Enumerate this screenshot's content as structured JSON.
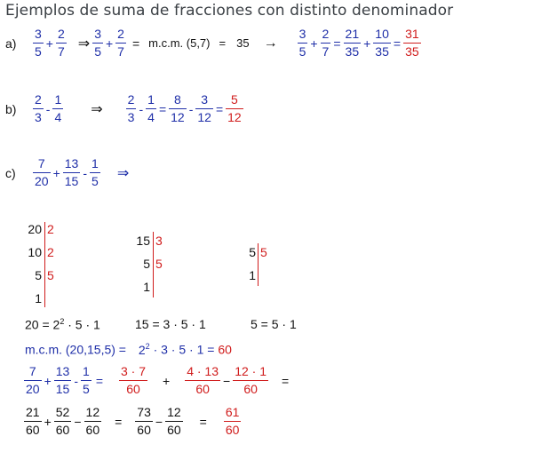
{
  "title": "Ejemplos de suma de fracciones con distinto denominador",
  "colors": {
    "blue": "#1f2fa8",
    "red": "#d01c1c",
    "title": "#3a3f44"
  },
  "a": {
    "label": "a)",
    "f1n": "3",
    "f1d": "5",
    "plus": "+",
    "f2n": "2",
    "f2d": "7",
    "implies": "⇒",
    "f3n": "3",
    "f3d": "5",
    "f4n": "2",
    "f4d": "7",
    "eq": "=",
    "mcm": "m.c.m. (5,7)",
    "eq2": "=",
    "mcm_val": "35",
    "arrow": "→",
    "g1n": "3",
    "g1d": "5",
    "g2n": "2",
    "g2d": "7",
    "h1n": "21",
    "h1d": "35",
    "h2n": "10",
    "h2d": "35",
    "rn": "31",
    "rd": "35"
  },
  "b": {
    "label": "b)",
    "f1n": "2",
    "f1d": "3",
    "minus": "-",
    "f2n": "1",
    "f2d": "4",
    "implies": "⇒",
    "g1n": "2",
    "g1d": "3",
    "g2n": "1",
    "g2d": "4",
    "h1n": "8",
    "h1d": "12",
    "h2n": "3",
    "h2d": "12",
    "rn": "5",
    "rd": "12"
  },
  "c": {
    "label": "c)",
    "f1n": "7",
    "f1d": "20",
    "f2n": "13",
    "f2d": "15",
    "f3n": "1",
    "f3d": "5",
    "implies": "⇒"
  },
  "div20": {
    "left": [
      "20",
      "10",
      "5",
      "1"
    ],
    "right": [
      "2",
      "2",
      "5"
    ]
  },
  "div15": {
    "left": [
      "15",
      "5",
      "1"
    ],
    "right": [
      "3",
      "5"
    ]
  },
  "div5": {
    "left": [
      "5",
      "1"
    ],
    "right": [
      "5"
    ]
  },
  "factor": {
    "f20a": "20 = 2",
    "f20exp": "2",
    "f20b": " · 5 · 1",
    "f15": "15 = 3 · 5 · 1",
    "f5": "5 = 5 · 1"
  },
  "mcm_line": {
    "text": "m.c.m. (20,15,5)  =",
    "prod_a": "2",
    "prod_exp": "2",
    "prod_b": " · 3 · 5 · 1 =",
    "result": "60"
  },
  "step1": {
    "f1n": "7",
    "f1d": "20",
    "f2n": "13",
    "f2d": "15",
    "f3n": "1",
    "f3d": "5",
    "p1n": "3 · 7",
    "p1d": "60",
    "p2n": "4 · 13",
    "p2d": "60",
    "p3n": "12 · 1",
    "p3d": "60"
  },
  "step2": {
    "a1n": "21",
    "a1d": "60",
    "a2n": "52",
    "a2d": "60",
    "a3n": "12",
    "a3d": "60",
    "b1n": "73",
    "b1d": "60",
    "b2n": "12",
    "b2d": "60",
    "rn": "61",
    "rd": "60"
  },
  "ops": {
    "plus": "+",
    "minus": "-",
    "minus_long": "−",
    "eq": "="
  }
}
